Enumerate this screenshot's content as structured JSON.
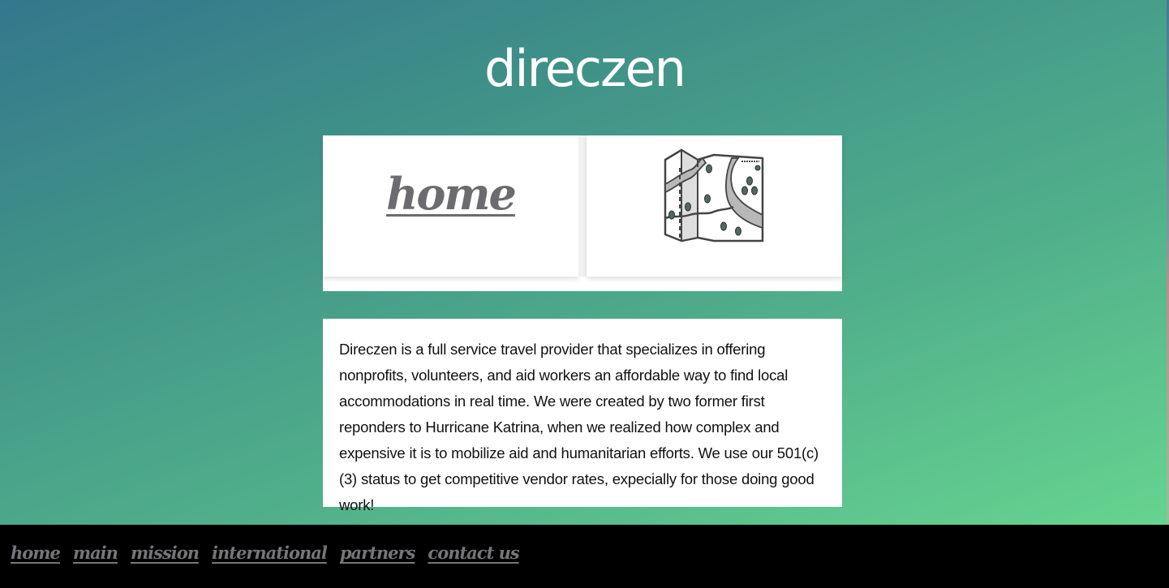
{
  "site": {
    "title": "direczen"
  },
  "cards": {
    "home_link": "home",
    "map_icon": "folded-map-icon"
  },
  "about": {
    "text": "Direczen is a full service travel provider that specializes in offering nonprofits, volunteers, and aid workers an affordable way to find local accommodations in real time. We were created by two former first reponders to Hurricane Katrina, when we realized how complex and expensive it is to mobilize aid and humanitarian efforts. We use our 501(c)(3) status to get competitive vendor rates, expecially for those doing good work!"
  },
  "footer": {
    "links": [
      {
        "label": "home"
      },
      {
        "label": "main"
      },
      {
        "label": "mission"
      },
      {
        "label": "international"
      },
      {
        "label": "partners"
      },
      {
        "label": "contact us"
      }
    ]
  },
  "colors": {
    "gradient_top": "#34778d",
    "gradient_bottom": "#66d48f",
    "link_gray": "#6c6c70",
    "footer_bg": "#000000"
  }
}
